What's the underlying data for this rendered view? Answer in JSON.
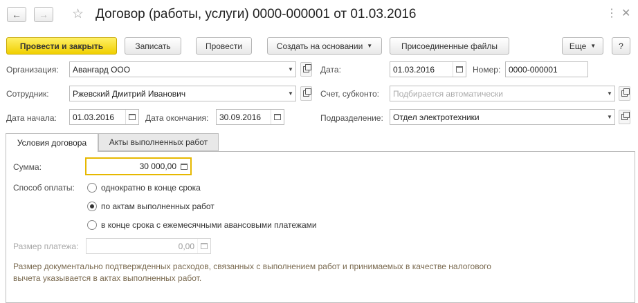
{
  "header": {
    "title": "Договор (работы, услуги) 0000-000001 от 01.03.2016",
    "more_icon": "vertical-dots-icon",
    "close_icon": "x-icon"
  },
  "toolbar": {
    "post_close": "Провести и закрыть",
    "save": "Записать",
    "post": "Провести",
    "create_based": "Создать на основании",
    "attached_files": "Присоединенные файлы",
    "more": "Еще",
    "help": "?"
  },
  "form": {
    "org_label": "Организация:",
    "org_value": "Авангард ООО",
    "employee_label": "Сотрудник:",
    "employee_value": "Ржевский Дмитрий Иванович",
    "start_label": "Дата начала:",
    "start_value": "01.03.2016",
    "end_label": "Дата окончания:",
    "end_value": "30.09.2016",
    "date_label": "Дата:",
    "date_value": "01.03.2016",
    "number_label": "Номер:",
    "number_value": "0000-000001",
    "account_label": "Счет, субконто:",
    "account_placeholder": "Подбирается автоматически",
    "division_label": "Подразделение:",
    "division_value": "Отдел электротехники"
  },
  "tabs": [
    {
      "label": "Условия договора",
      "active": true
    },
    {
      "label": "Акты выполненных работ",
      "active": false
    }
  ],
  "conditions": {
    "sum_label": "Сумма:",
    "sum_value": "30 000,00",
    "payment_label": "Способ оплаты:",
    "options": [
      {
        "label": "однократно в конце срока",
        "selected": false
      },
      {
        "label": "по актам выполненных работ",
        "selected": true
      },
      {
        "label": "в конце срока с ежемесячными авансовыми платежами",
        "selected": false
      }
    ],
    "payment_size_label": "Размер платежа:",
    "payment_size_value": "0,00",
    "note": "Размер документально подтвержденных расходов, связанных с выполнением работ и принимаемых в качестве налогового вычета указывается в актах выполненных работ."
  },
  "colors": {
    "primary_button": "#f5d800",
    "sum_border": "#e6b800",
    "note_text": "#7a6a50"
  }
}
